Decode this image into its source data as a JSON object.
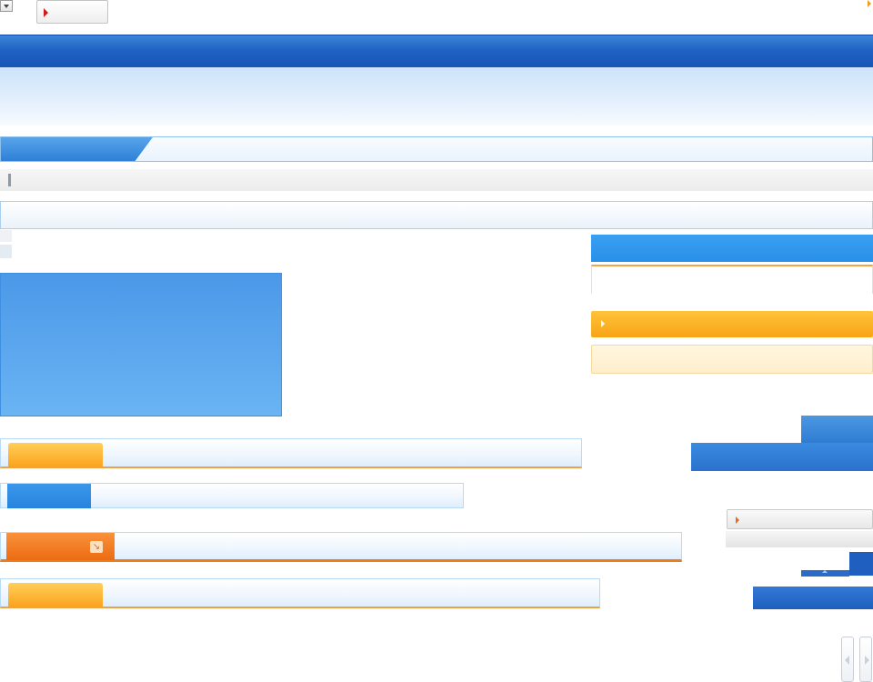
{
  "icons": {
    "top_dropdown": "chevron-down-icon",
    "top_button_marker": "play-arrow-icon",
    "top_right_marker": "arrow-right-icon",
    "orange_bar_marker": "play-arrow-icon",
    "grey_button_marker": "play-arrow-icon",
    "tab_expand": "external-arrow-icon",
    "scroll_left": "chevron-left-icon",
    "scroll_right": "chevron-right-icon"
  },
  "glyphs": {
    "tab_expand": "↘"
  },
  "colors": {
    "header_blue": "#1f63c4",
    "hero_light_blue": "#cde3fa",
    "accent_orange": "#f8a316",
    "accent_dark_orange": "#ec6b13",
    "panel_blue": "#4b98e8",
    "cream": "#fff6df",
    "marker_red": "#d11a1a"
  }
}
